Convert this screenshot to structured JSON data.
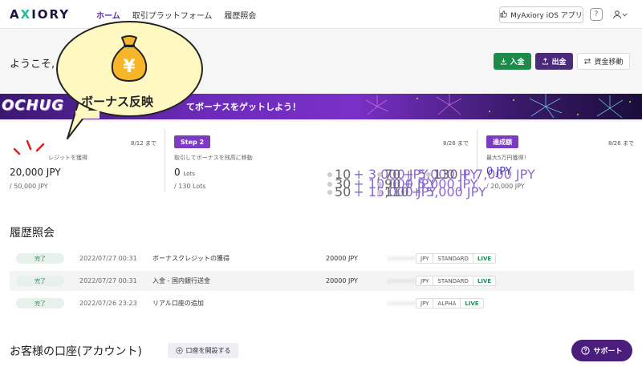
{
  "header": {
    "logo_a": "A",
    "logo_x": "X",
    "logo_rest": "IORY",
    "nav": [
      {
        "label": "ホーム",
        "active": true
      },
      {
        "label": "取引プラットフォーム",
        "active": false
      },
      {
        "label": "履歴照会",
        "active": false
      }
    ],
    "ios_app": "MyAxiory iOS アプリ",
    "help": "?"
  },
  "welcome": "ようこそ,",
  "actions": {
    "deposit": "入金",
    "withdraw": "出金",
    "transfer": "資金移動"
  },
  "banner": {
    "logo": "OCHUG",
    "text": "てボーナスをゲットしよう！"
  },
  "bubble": {
    "text": "ボーナス反映",
    "yen": "¥"
  },
  "steps": {
    "step1": {
      "date": "8/12 まで",
      "desc": "レジットを獲得",
      "amount": "20,000 JPY",
      "sub": "/ 50,000 JPY"
    },
    "step2": {
      "badge": "Step 2",
      "date": "8/26 まで",
      "desc": "取引してボーナスを残高に移動",
      "amount": "0",
      "amount_unit": "Lots",
      "sub": "/ 130 Lots",
      "lots": [
        {
          "num": "10",
          "bonus": "+ 3,000 JPY"
        },
        {
          "num": "70",
          "bonus": "+ 5,000 JPY"
        },
        {
          "num": "130",
          "bonus": "+ 7,000 JPY"
        },
        {
          "num": "30",
          "bonus": "+ 10,000 JPY"
        },
        {
          "num": "90",
          "bonus": "+ 5,000 JPY"
        },
        {
          "num": "50",
          "bonus": "+ 15,000 JPY"
        },
        {
          "num": "110",
          "bonus": "+ 5,000 JPY"
        }
      ]
    },
    "step3": {
      "badge": "達成額",
      "date": "8/26 まで",
      "desc": "最大5万円獲得！",
      "amount": "0 JPY",
      "sub": "/ 20,000 JPY"
    }
  },
  "history": {
    "title": "履歴照会",
    "rows": [
      {
        "status": "完了",
        "date": "2022/07/27 00:31",
        "desc": "ボーナスクレジットの獲得",
        "amount": "20000 JPY",
        "account": "10000000",
        "currency": "JPY",
        "type": "STANDARD",
        "env": "LIVE"
      },
      {
        "status": "完了",
        "date": "2022/07/27 00:31",
        "desc": "入金 - 国内銀行送金",
        "amount": "20000 JPY",
        "account": "10000000",
        "currency": "JPY",
        "type": "STANDARD",
        "env": "LIVE"
      },
      {
        "status": "完了",
        "date": "2022/07/26 23:23",
        "desc": "リアル口座の追加",
        "amount": "",
        "account": "10000000",
        "currency": "JPY",
        "type": "ALPHA",
        "env": "LIVE"
      }
    ]
  },
  "accounts": {
    "title": "お客様の口座(アカウント)",
    "open_button": "口座を開設する"
  },
  "support": "サポート",
  "colors": {
    "brand_purple": "#4a1e7a",
    "accent_green": "#1d8a4a",
    "logo_teal": "#28b89a"
  }
}
